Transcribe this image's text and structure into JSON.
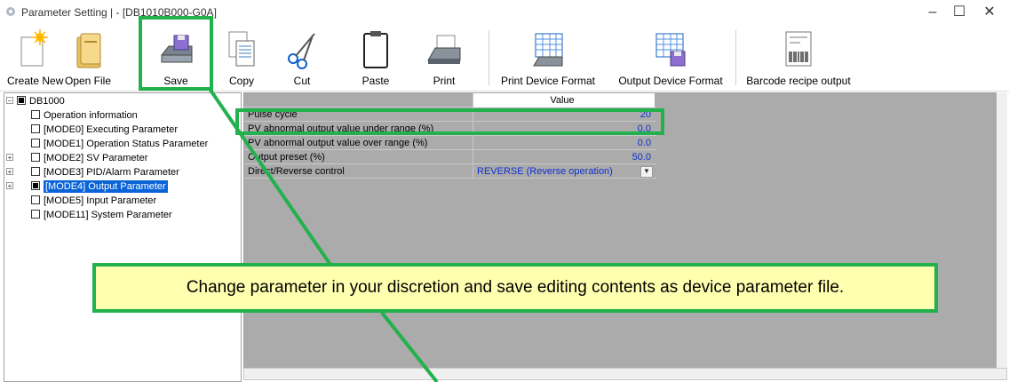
{
  "window": {
    "title": "Parameter Setting |  - [DB1010B000-G0A]",
    "minimize": "–",
    "maximize": "☐",
    "close": "✕"
  },
  "toolbar": {
    "create_new": "Create New",
    "open_file": "Open File",
    "save": "Save",
    "copy": "Copy",
    "cut": "Cut",
    "paste": "Paste",
    "print": "Print",
    "print_device_format": "Print Device Format",
    "output_device_format": "Output Device Format",
    "barcode_recipe_output": "Barcode recipe output"
  },
  "tree": {
    "root": "DB1000",
    "items": [
      {
        "label": "Operation information",
        "expandable": false,
        "checked": false,
        "selected": false
      },
      {
        "label": "[MODE0] Executing Parameter",
        "expandable": false,
        "checked": false,
        "selected": false
      },
      {
        "label": "[MODE1] Operation Status Parameter",
        "expandable": false,
        "checked": false,
        "selected": false
      },
      {
        "label": "[MODE2] SV Parameter",
        "expandable": true,
        "checked": false,
        "selected": false
      },
      {
        "label": "[MODE3] PID/Alarm Parameter",
        "expandable": true,
        "checked": false,
        "selected": false
      },
      {
        "label": "[MODE4] Output Parameter",
        "expandable": true,
        "checked": true,
        "selected": true
      },
      {
        "label": "[MODE5] Input Parameter",
        "expandable": false,
        "checked": false,
        "selected": false
      },
      {
        "label": "[MODE11] System Parameter",
        "expandable": false,
        "checked": false,
        "selected": false
      }
    ]
  },
  "table": {
    "header_value": "Value",
    "rows": [
      {
        "name": "Pulse cycle",
        "value": "20"
      },
      {
        "name": "PV abnormal output value under range (%)",
        "value": "0.0"
      },
      {
        "name": "PV abnormal output value over range (%)",
        "value": "0.0"
      },
      {
        "name": "Output preset (%)",
        "value": "50.0"
      },
      {
        "name": "Direct/Reverse control",
        "value": "REVERSE (Reverse operation)"
      }
    ]
  },
  "callout": {
    "text": "Change parameter in your discretion and save editing contents as device parameter file."
  },
  "colors": {
    "highlight": "#22b14c",
    "callout_bg": "#ffffb0",
    "selection": "#0a64d8",
    "value_text": "#1030d0"
  }
}
